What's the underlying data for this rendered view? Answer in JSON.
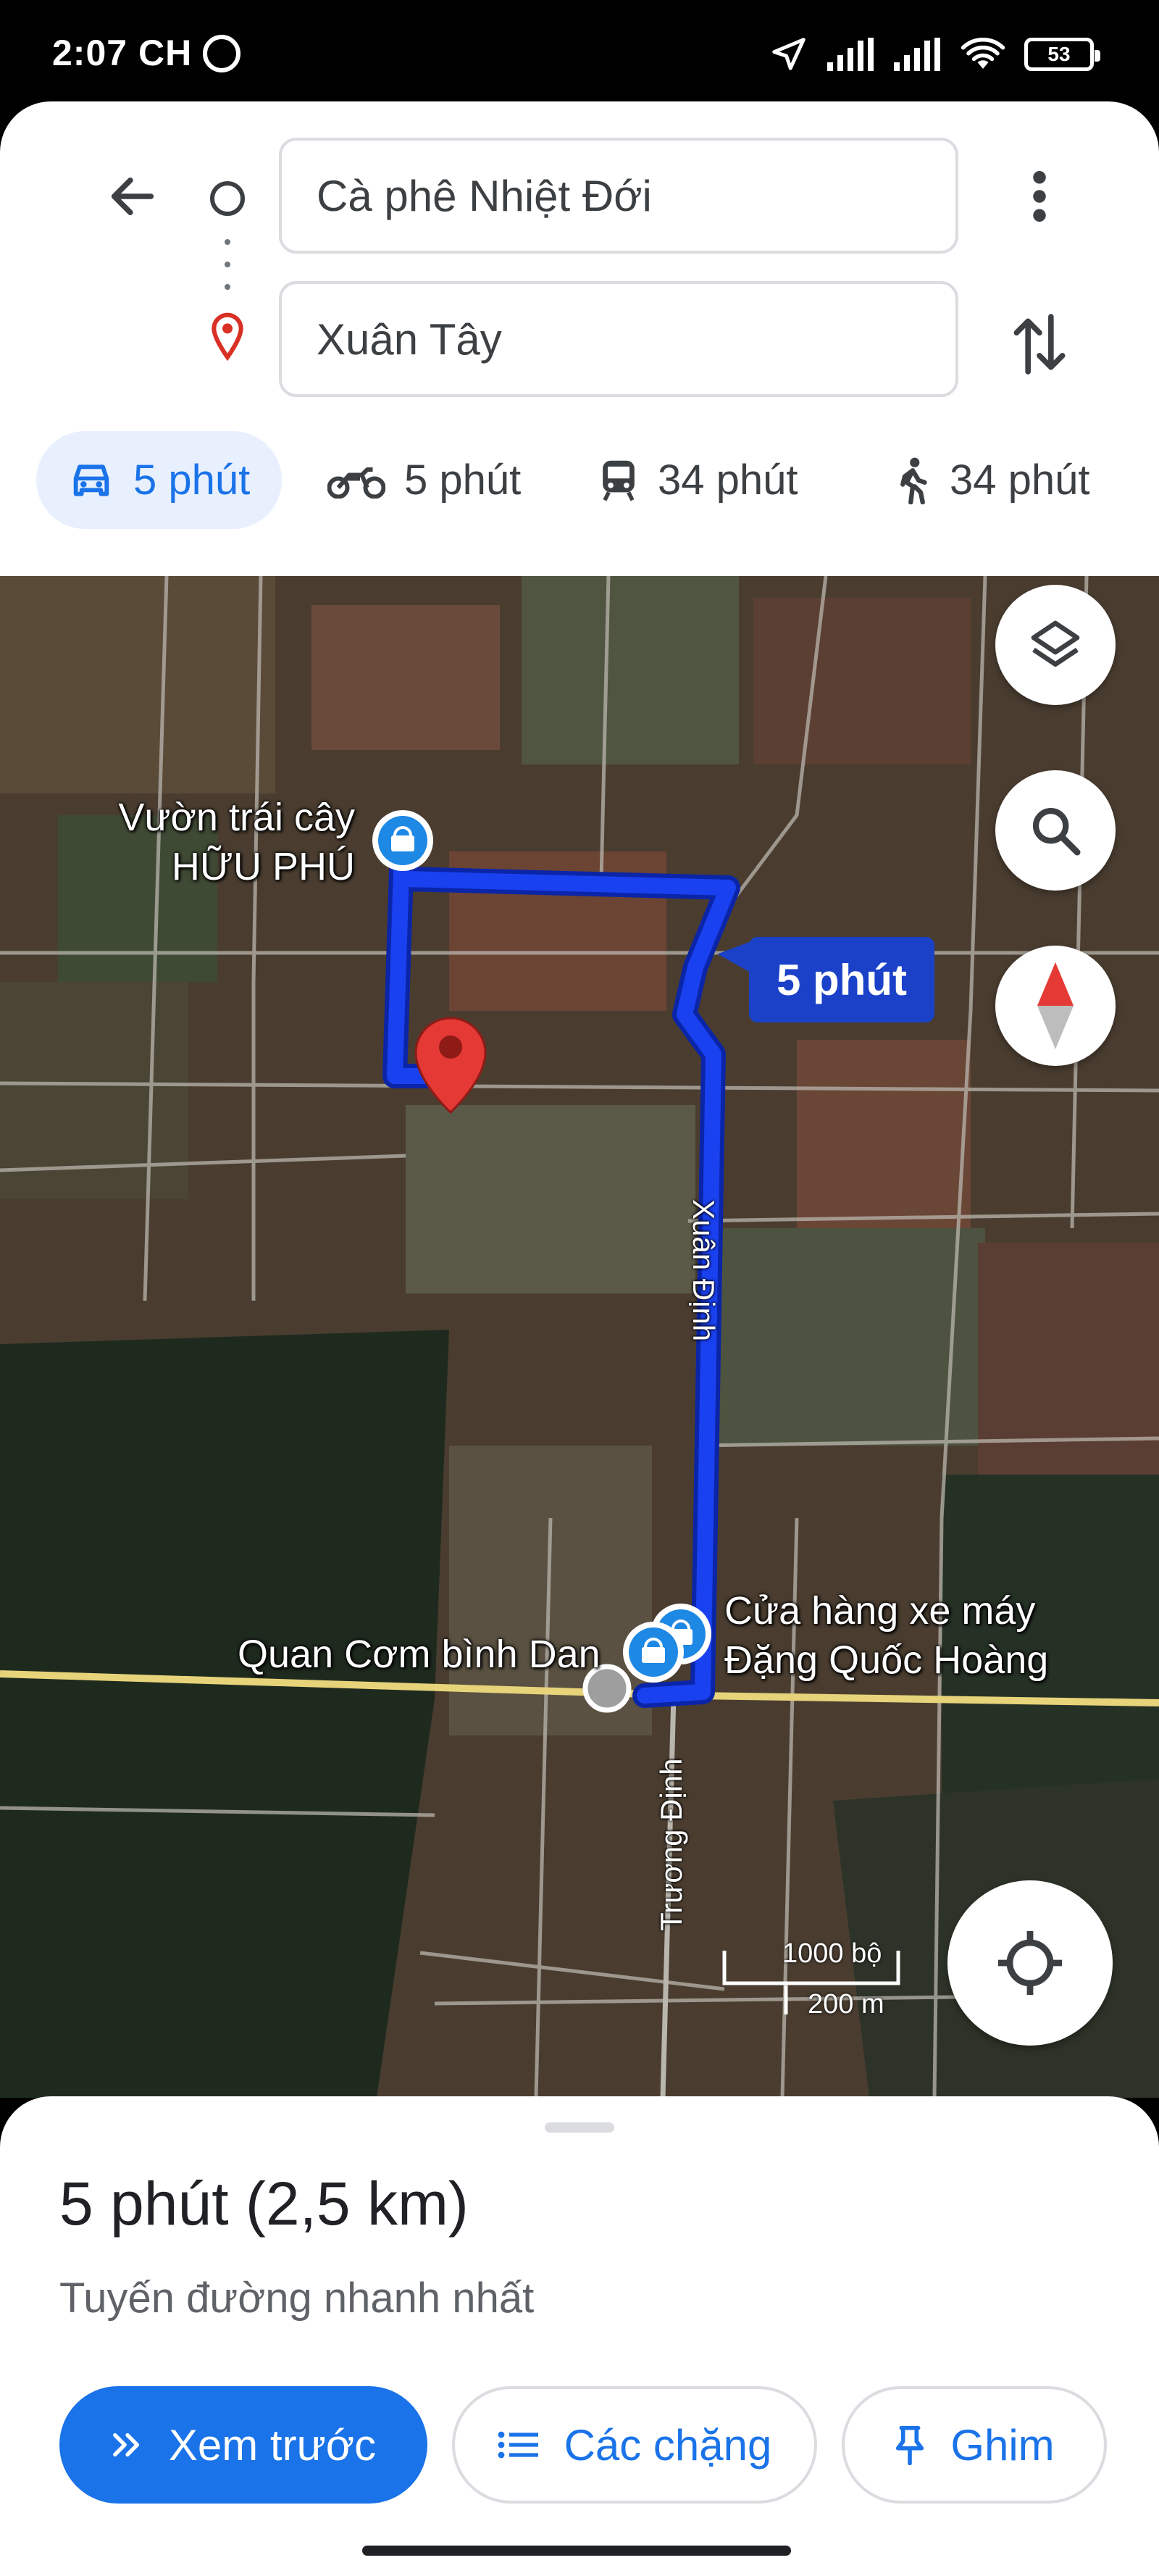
{
  "status_bar": {
    "time": "2:07 CH",
    "battery": "53"
  },
  "directions": {
    "origin": "Cà phê Nhiệt Đới",
    "destination": "Xuân Tây",
    "modes": [
      {
        "icon": "car-icon",
        "label": "5 phút",
        "active": true
      },
      {
        "icon": "motorbike-icon",
        "label": "5 phút",
        "active": false
      },
      {
        "icon": "transit-icon",
        "label": "34 phút",
        "active": false
      },
      {
        "icon": "walk-icon",
        "label": "34 phút",
        "active": false
      }
    ]
  },
  "map": {
    "route_time_badge": "5 phút",
    "places": {
      "fruit_garden": "Vườn trái cây HỮU PHÚ",
      "motorbike_shop": "Cửa hàng xe máy Đặng Quốc Hoàng",
      "restaurant": "Quan Cơm bình Dan"
    },
    "streets": {
      "xuan_dinh": "Xuân Định",
      "truong_dinh": "Trương Định"
    },
    "scale": {
      "imperial": "1000 bộ",
      "metric": "200 m"
    },
    "route_color": "#1a41f0"
  },
  "sheet": {
    "summary": "5 phút (2,5 km)",
    "subtitle": "Tuyến đường nhanh nhất",
    "buttons": {
      "preview": "Xem trước",
      "steps": "Các chặng",
      "pin": "Ghim"
    }
  },
  "colors": {
    "accent": "#1a73e8",
    "accent_bg": "#e8f0fe",
    "pin_red": "#d93025"
  }
}
